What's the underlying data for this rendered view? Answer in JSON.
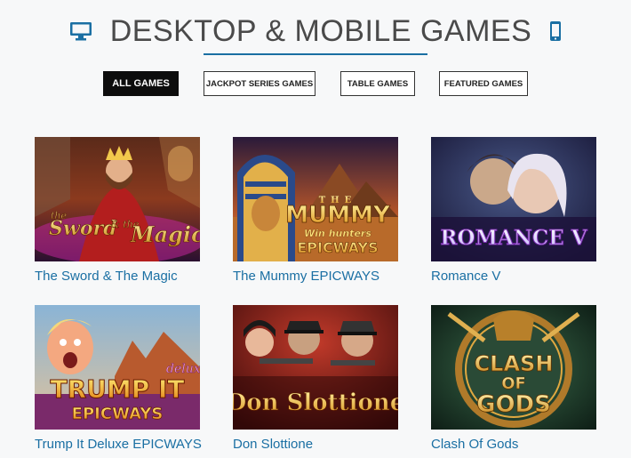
{
  "header": {
    "title": "DESKTOP & MOBILE GAMES",
    "left_icon": "desktop-monitor-icon",
    "right_icon": "mobile-phone-icon",
    "accent_color": "#1a6fa3"
  },
  "filters": [
    {
      "label": "ALL GAMES",
      "active": true
    },
    {
      "label": "JACKPOT SERIES GAMES",
      "active": false
    },
    {
      "label": "TABLE GAMES",
      "active": false
    },
    {
      "label": "FEATURED GAMES",
      "active": false
    }
  ],
  "games": [
    {
      "title": "The Sword & The Magic",
      "art_text": [
        "the",
        "Sword",
        "& the",
        "Magic"
      ]
    },
    {
      "title": "The Mummy EPICWAYS",
      "art_text": [
        "THE",
        "MUMMY",
        "Win hunters",
        "EPICWAYS"
      ]
    },
    {
      "title": "Romance V",
      "art_text": [
        "ROMANCE V"
      ]
    },
    {
      "title": "Trump It Deluxe EPICWAYS",
      "art_text": [
        "deluxe",
        "TRUMP IT",
        "EPICWAYS"
      ]
    },
    {
      "title": "Don Slottione",
      "art_text": [
        "Don Slottione"
      ]
    },
    {
      "title": "Clash Of Gods",
      "art_text": [
        "CLASH",
        "OF",
        "GODS"
      ]
    }
  ]
}
